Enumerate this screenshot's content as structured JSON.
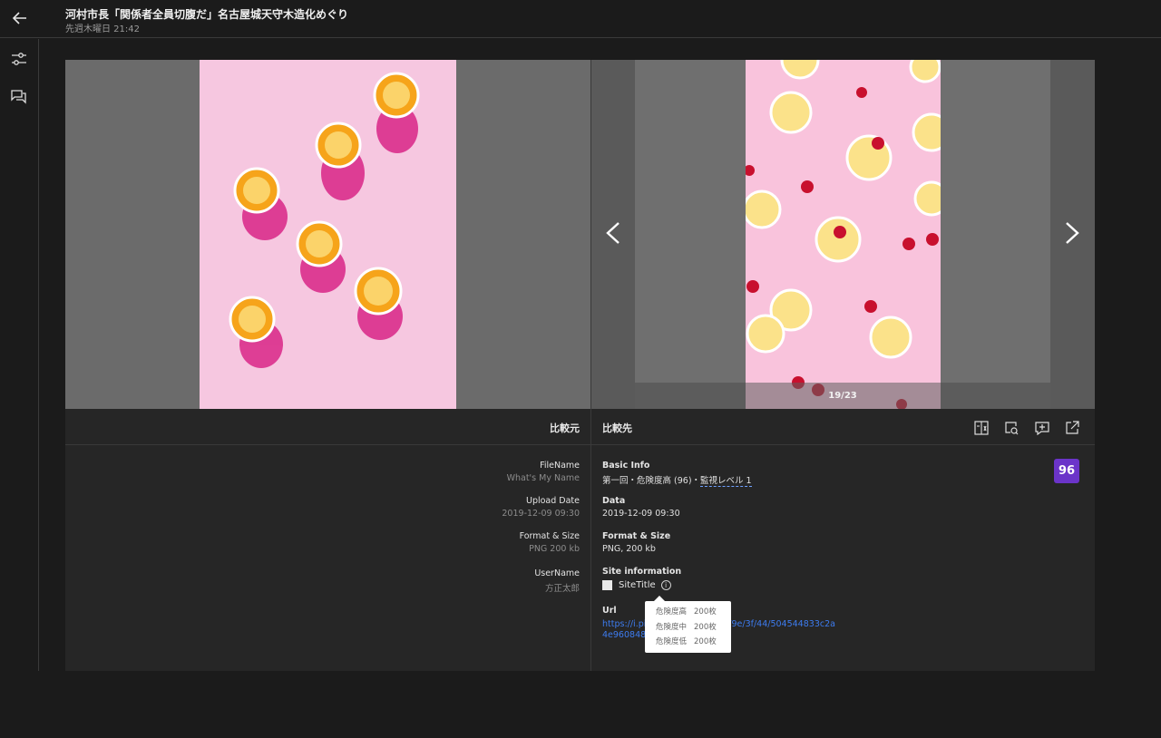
{
  "header": {
    "title": "河村市長「関係者全員切腹だ」名古屋城天守木造化めぐり",
    "subtitle": "先週木曜日 21:42"
  },
  "viewer": {
    "counter": "19/23"
  },
  "compare": {
    "source_label": "比較元",
    "target_label": "比較先"
  },
  "source_meta": [
    {
      "label": "FileName",
      "value": "What's My Name"
    },
    {
      "label": "Upload Date",
      "value": "2019-12-09 09:30"
    },
    {
      "label": "Format & Size",
      "value": "PNG 200 kb"
    },
    {
      "label": "UserName",
      "value": "方正太郎"
    }
  ],
  "target_meta": {
    "basic_info_label": "Basic Info",
    "basic_info_value": "第一回・危険度高 (96)・",
    "level_link": "監視レベル 1",
    "data_label": "Data",
    "data_value": "2019-12-09 09:30",
    "format_label": "Format & Size",
    "format_value": "PNG, 200 kb",
    "site_label": "Site information",
    "site_title": "SiteTitle",
    "url_label": "Url",
    "url_value": "https://i.pinimg.com/originals/9e/3f/44/504544833c2a4e960848ea6e1e",
    "score": "96"
  },
  "tooltip": {
    "rows": [
      {
        "label": "危険度高",
        "value": "200枚"
      },
      {
        "label": "危険度中",
        "value": "200枚"
      },
      {
        "label": "危険度低",
        "value": "200枚"
      }
    ]
  },
  "colors": {
    "accent": "#6b34c9",
    "link": "#3d7cf0"
  }
}
